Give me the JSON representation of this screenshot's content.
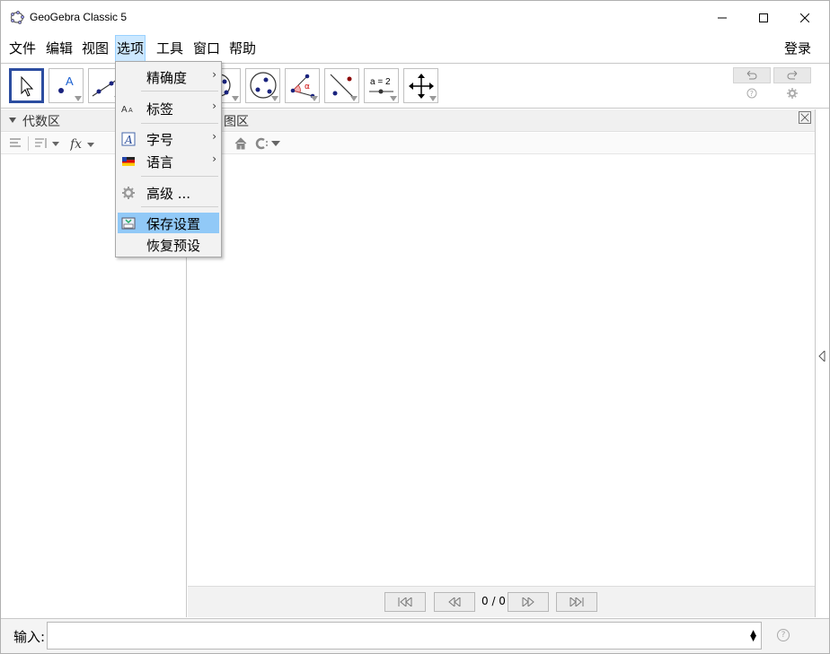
{
  "window": {
    "title": "GeoGebra Classic 5",
    "controls": {
      "minimize": "minimize",
      "maximize": "maximize",
      "close": "close"
    }
  },
  "menubar": {
    "items": [
      "文件",
      "编辑",
      "视图",
      "选项",
      "工具",
      "窗口",
      "帮助"
    ],
    "active_index": 3,
    "login": "登录"
  },
  "toolbar": {
    "tools": [
      {
        "icon": "move-arrow-icon",
        "selected": true
      },
      {
        "icon": "point-icon"
      },
      {
        "icon": "line-icon"
      },
      {
        "icon": "circle-center-icon"
      },
      {
        "icon": "circle-three-points-icon"
      },
      {
        "icon": "angle-icon"
      },
      {
        "icon": "reflect-line-icon"
      },
      {
        "icon": "slider-icon",
        "label": "a = 2"
      },
      {
        "icon": "move-graphics-icon"
      }
    ],
    "undo": "undo-icon",
    "redo": "redo-icon",
    "help": "help-icon",
    "settings": "gear-icon"
  },
  "algebra": {
    "title": "代数区"
  },
  "graphics": {
    "title": "绘图区",
    "title_visible": "图区"
  },
  "playbar": {
    "count": "0 / 0"
  },
  "input": {
    "label": "输入:",
    "value": ""
  },
  "options_menu": {
    "items": [
      {
        "label": "精确度",
        "submenu": true,
        "icon": ""
      },
      {
        "label": "标签",
        "submenu": true,
        "icon": "labeling-icon"
      },
      {
        "label": "字号",
        "submenu": true,
        "icon": "font-size-icon"
      },
      {
        "label": "语言",
        "submenu": true,
        "icon": "language-flag-icon"
      },
      {
        "label": "高级 ...",
        "submenu": false,
        "icon": "advanced-gear-icon"
      },
      {
        "label": "保存设置",
        "submenu": false,
        "icon": "save-settings-icon",
        "highlighted": true
      },
      {
        "label": "恢复预设",
        "submenu": false,
        "icon": ""
      }
    ]
  },
  "colors": {
    "accent": "#2c4da0",
    "menu_highlight": "#91c9f7",
    "menu_active": "#cce8ff"
  }
}
